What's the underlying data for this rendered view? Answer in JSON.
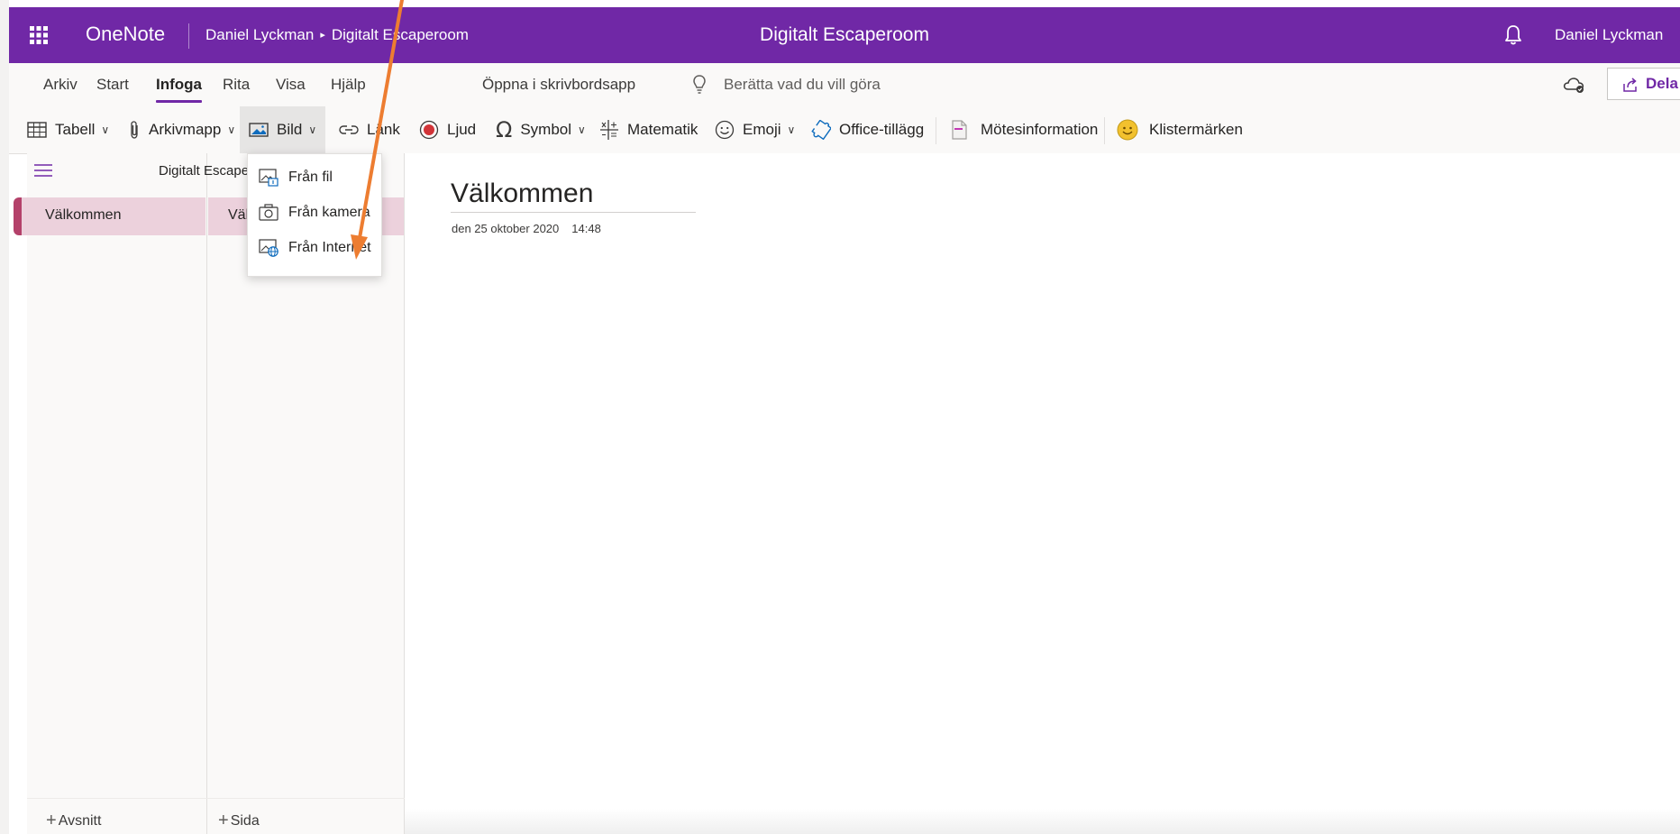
{
  "titlebar": {
    "app_name": "OneNote",
    "breadcrumb_owner": "Daniel Lyckman",
    "breadcrumb_separator": "▸",
    "breadcrumb_notebook": "Digitalt Escaperoom",
    "document_title": "Digitalt Escaperoom",
    "user_name": "Daniel Lyckman",
    "accent_color": "#7028a6"
  },
  "menu_tabs": [
    "Arkiv",
    "Start",
    "Infoga",
    "Rita",
    "Visa",
    "Hjälp"
  ],
  "active_tab": "Infoga",
  "open_desktop_app": "Öppna i skrivbordsapp",
  "tell_me": "Berätta vad du vill göra",
  "share_label": "Dela",
  "ribbon": {
    "table": "Tabell",
    "attachment": "Arkivmapp",
    "picture": "Bild",
    "link": "Länk",
    "audio": "Ljud",
    "symbol": "Symbol",
    "math": "Matematik",
    "emoji": "Emoji",
    "addins": "Office-tillägg",
    "meeting": "Mötesinformation",
    "stickers": "Klistermärken"
  },
  "picture_menu": {
    "items": [
      "Från fil",
      "Från kamera",
      "Från Internet"
    ]
  },
  "navigation": {
    "notebook_name": "Digitalt Escaperoom",
    "section": "Välkommen",
    "page": "Välkommen",
    "section_color": "#b4416a",
    "add_section": "Avsnitt",
    "add_page": "Sida"
  },
  "page": {
    "title": "Välkommen",
    "date": "den 25 oktober 2020",
    "time": "14:48"
  },
  "annotation": {
    "arrow_color": "#ed7d31"
  }
}
